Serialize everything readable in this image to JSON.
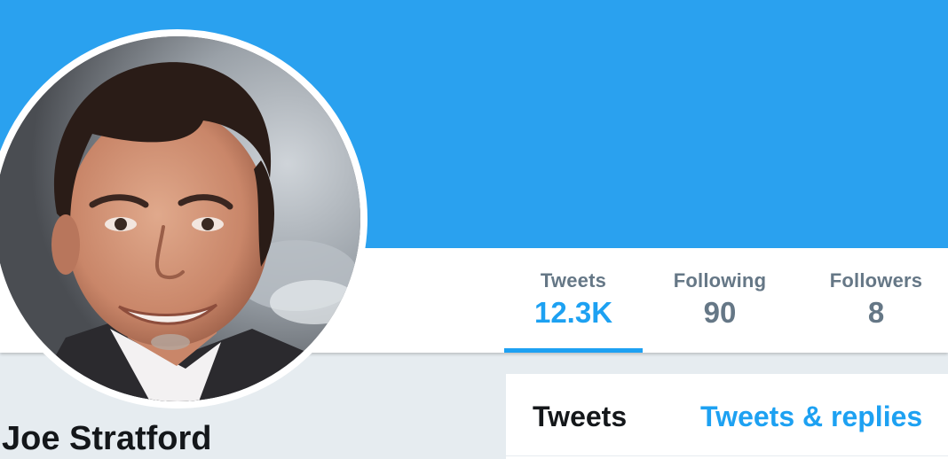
{
  "colors": {
    "banner": "#2aa1ef",
    "accent": "#1da1f2",
    "muted": "#657786",
    "text": "#14171a",
    "page_bg": "#e6ecf0"
  },
  "profile": {
    "name": "Joe Stratford",
    "avatar": "profile-photo"
  },
  "stats": [
    {
      "label": "Tweets",
      "value": "12.3K",
      "active": true
    },
    {
      "label": "Following",
      "value": "90",
      "active": false
    },
    {
      "label": "Followers",
      "value": "8",
      "active": false
    }
  ],
  "timeline": {
    "tabs": [
      {
        "label": "Tweets",
        "active": true
      },
      {
        "label": "Tweets & replies",
        "active": false
      }
    ]
  }
}
